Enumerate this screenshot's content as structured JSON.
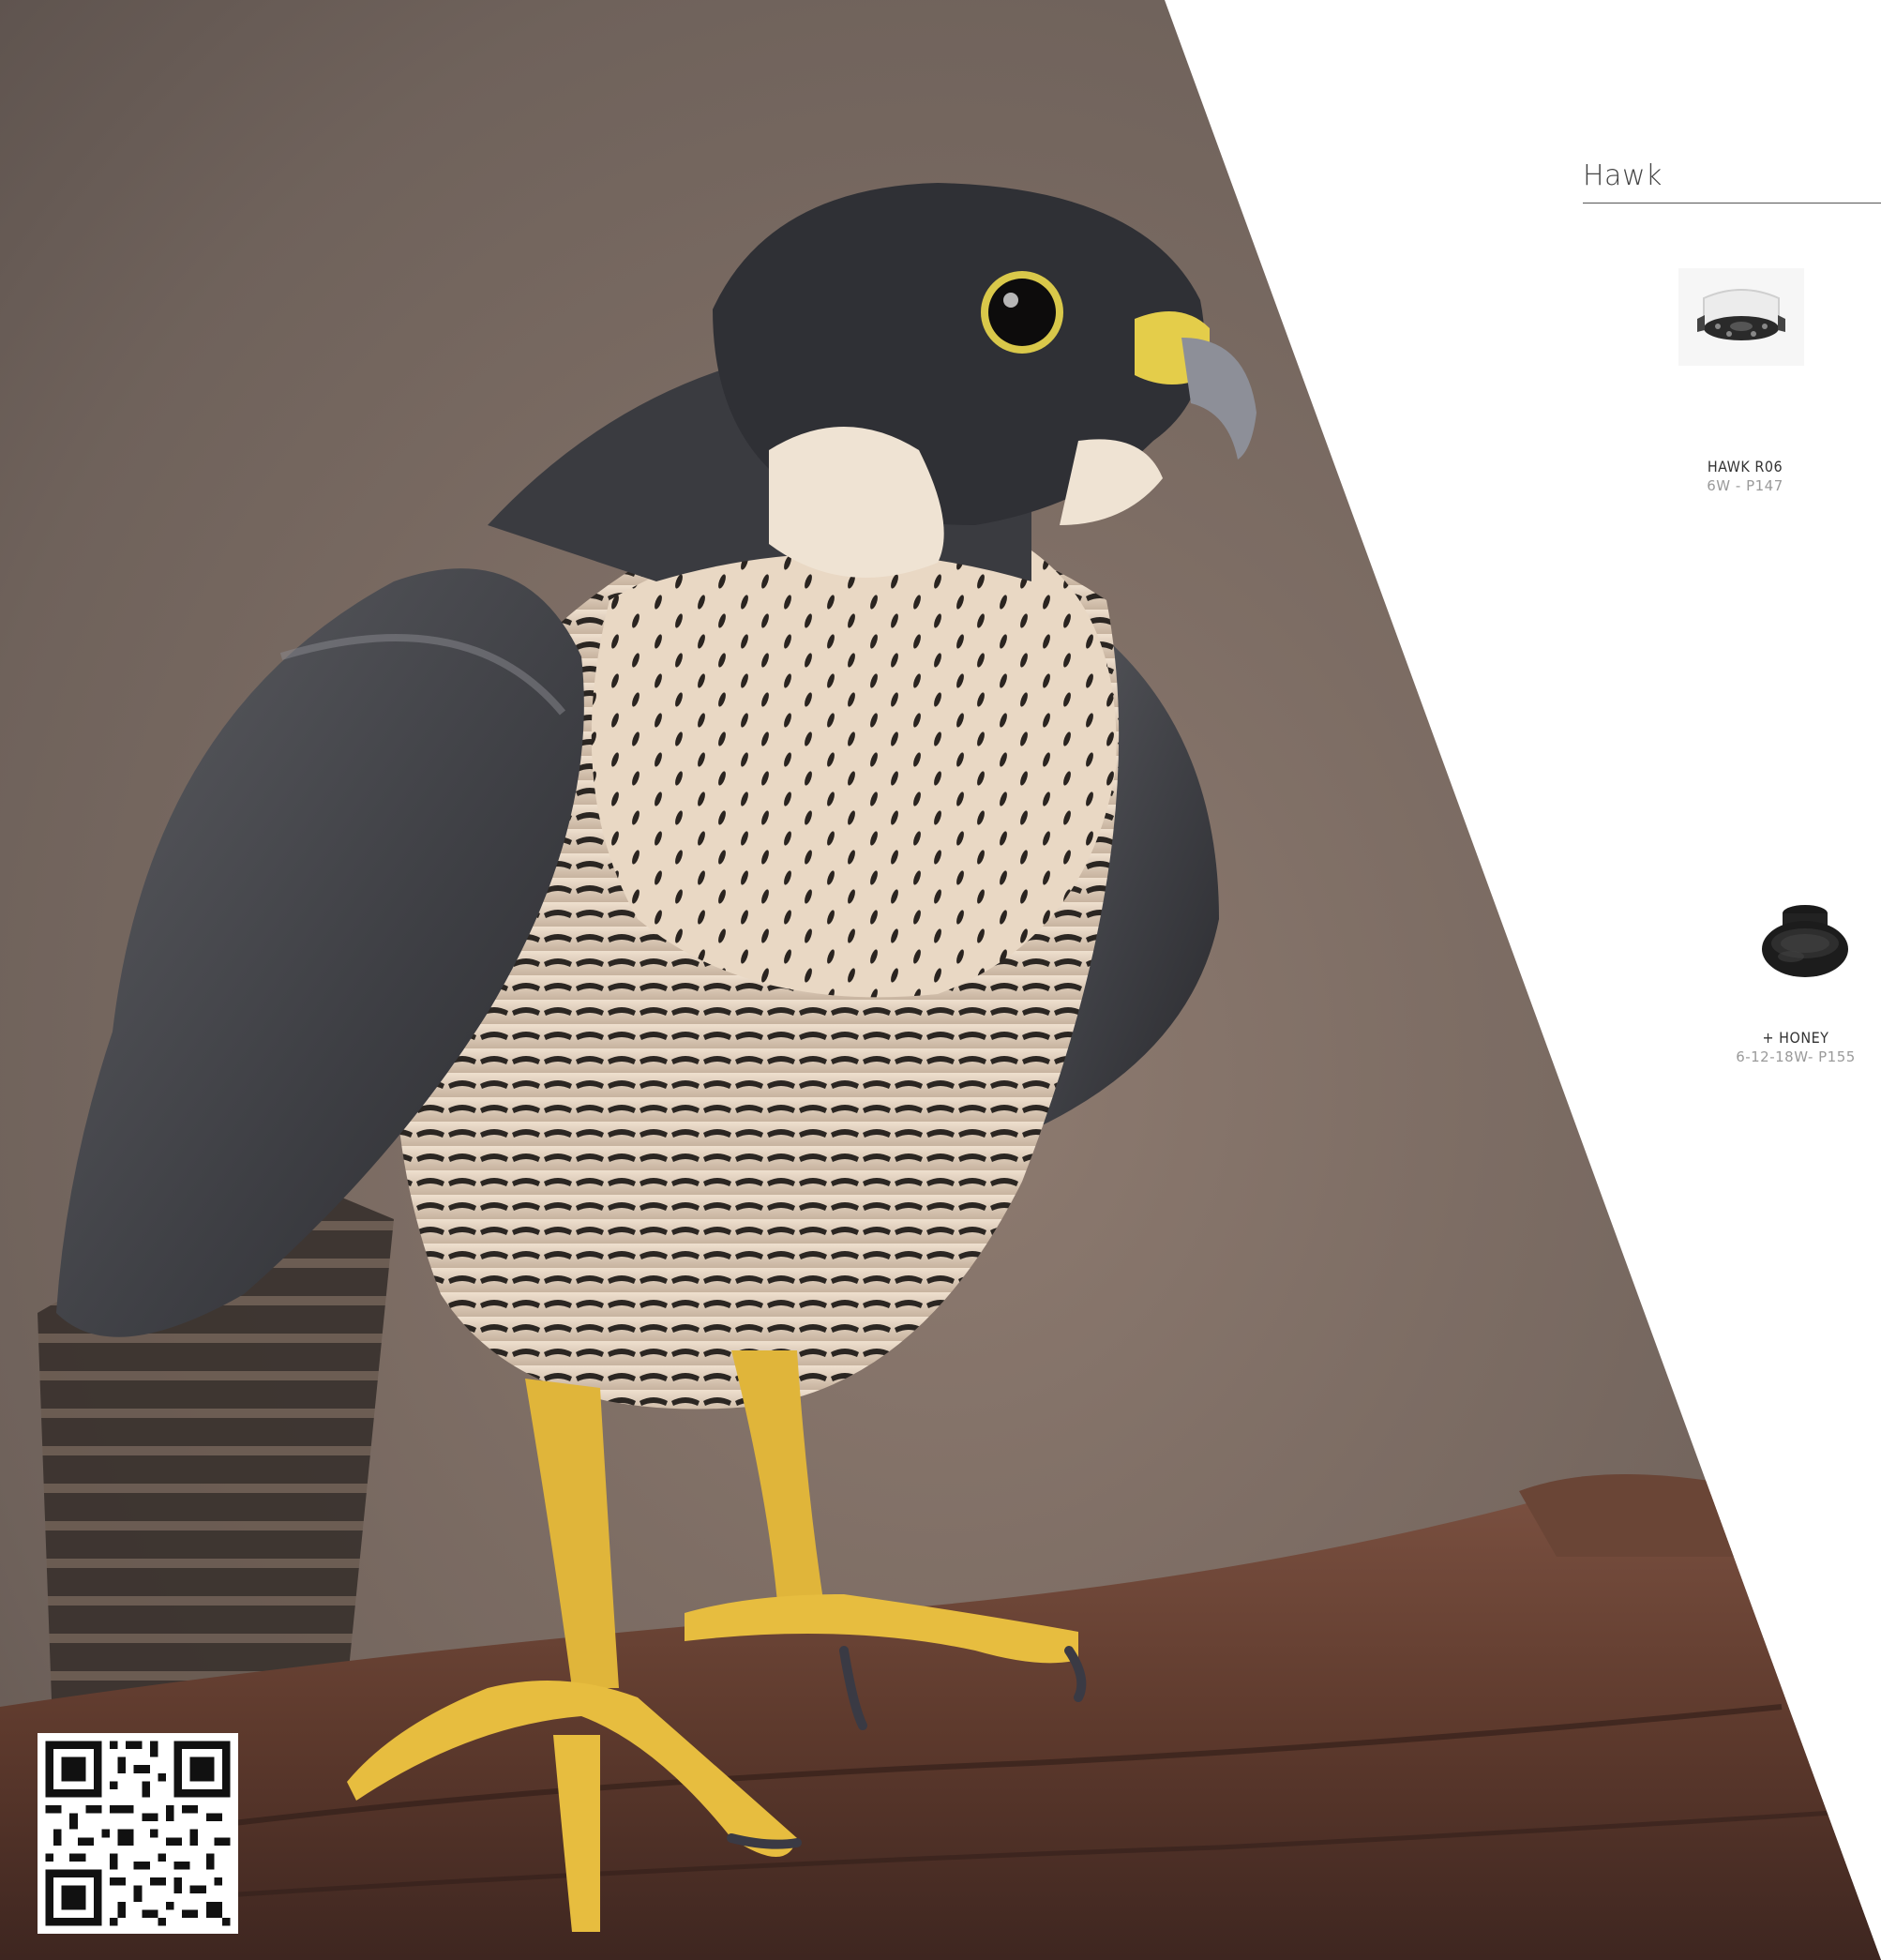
{
  "section": {
    "title": "Hawk"
  },
  "products": [
    {
      "name": "HAWK R06",
      "spec": "6W - P147",
      "icon": "recessed-downlight-white-icon"
    },
    {
      "name": "+ HONEY",
      "spec": "6-12-18W- P155",
      "icon": "honeycomb-accessory-black-icon"
    }
  ],
  "photo": {
    "subject": "peregrine-falcon-on-log"
  },
  "qr_code": {
    "icon": "qr-code-icon"
  }
}
